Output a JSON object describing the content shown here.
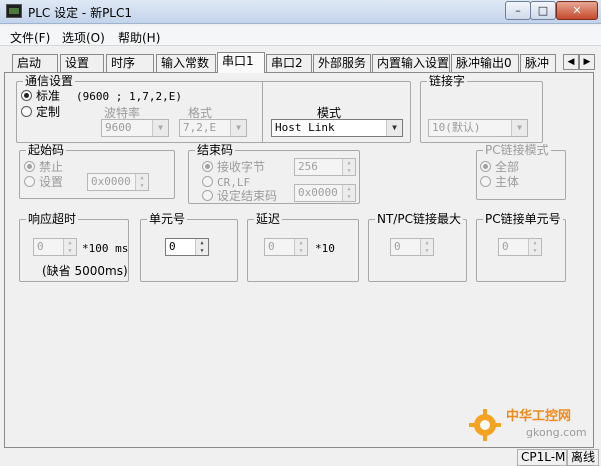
{
  "window": {
    "title": "PLC 设定 - 新PLC1",
    "buttons": {
      "minimize": "–",
      "maximize": "□",
      "close": "✕"
    }
  },
  "menu": [
    "文件(F)",
    "选项(O)",
    "帮助(H)"
  ],
  "tabs": [
    "启动",
    "设置",
    "时序",
    "输入常数",
    "串口1",
    "串口2",
    "外部服务",
    "内置输入设置",
    "脉冲输出0",
    "脉冲"
  ],
  "active_tab": "串口1",
  "comm": {
    "title": "通信设置",
    "standard_label": "标准",
    "standard_value": "(9600 ; 1,7,2,E)",
    "custom_label": "定制",
    "baud_label": "波特率",
    "baud_value": "9600",
    "format_label": "格式",
    "format_value": "7,2,E",
    "mode_label": "模式",
    "mode_value": "Host Link"
  },
  "link": {
    "title": "链接字",
    "value": "10(默认)"
  },
  "start_code": {
    "title": "起始码",
    "disable_label": "禁止",
    "set_label": "设置",
    "value": "0x0000"
  },
  "end_code": {
    "title": "结束码",
    "recv_bytes_label": "接收字节",
    "recv_bytes_value": "256",
    "crlf_label": "CR,LF",
    "set_end_label": "设定结束码",
    "end_code_value": "0x0000"
  },
  "pc_link_mode": {
    "title": "PC链接模式",
    "all_label": "全部",
    "master_label": "主体"
  },
  "timeout": {
    "title": "响应超时",
    "value": "0",
    "unit": "*100 ms",
    "note": "(缺省 5000ms)"
  },
  "unit_no": {
    "title": "单元号",
    "value": "0"
  },
  "delay": {
    "title": "延迟",
    "value": "0",
    "unit": "*10"
  },
  "nt_max": {
    "title": "NT/PC链接最大",
    "value": "0"
  },
  "pc_unit": {
    "title": "PC链接单元号",
    "value": "0"
  },
  "status": {
    "model": "CP1L-M",
    "state": "离线"
  },
  "watermark": {
    "text1": "中华工控网",
    "text2": "gkong.com"
  }
}
